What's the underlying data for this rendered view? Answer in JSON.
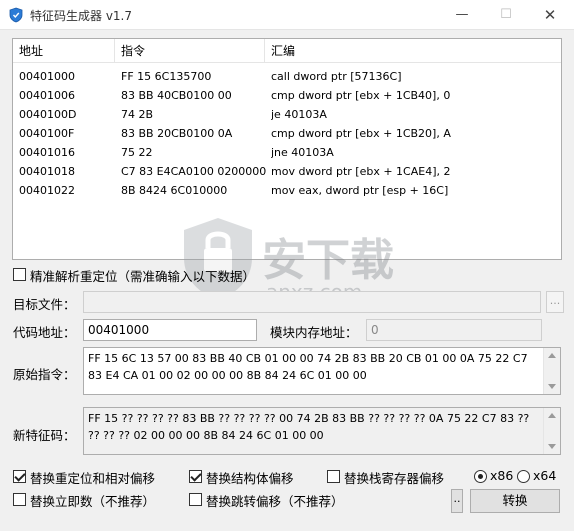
{
  "window": {
    "title": "特征码生成器 v1.7",
    "min_glyph": "—",
    "max_glyph": "☐",
    "close_glyph": "✕"
  },
  "listview": {
    "columns": [
      "地址",
      "指令",
      "汇编"
    ],
    "rows": [
      [
        "00401000",
        "FF 15 6C135700",
        "call dword ptr [57136C]"
      ],
      [
        "00401006",
        "83 BB 40CB0100 00",
        "cmp dword ptr [ebx + 1CB40], 0"
      ],
      [
        "0040100D",
        "74 2B",
        "je 40103A"
      ],
      [
        "0040100F",
        "83 BB 20CB0100 0A",
        "cmp dword ptr [ebx + 1CB20], A"
      ],
      [
        "00401016",
        "75 22",
        "jne 40103A"
      ],
      [
        "00401018",
        "C7 83 E4CA0100 02000000",
        "mov dword ptr [ebx + 1CAE4], 2"
      ],
      [
        "00401022",
        "8B 8424 6C010000",
        "mov eax, dword ptr [esp + 16C]"
      ]
    ]
  },
  "precise": {
    "label": "精准解析重定位（需准确输入以下数据）",
    "checked": false
  },
  "target_file": {
    "label": "目标文件：",
    "value": "",
    "browse_label": "..."
  },
  "code_address": {
    "label": "代码地址：",
    "value": "00401000"
  },
  "module_base": {
    "label": "模块内存地址：",
    "value": "0"
  },
  "original_code": {
    "label": "原始指令：",
    "value": "FF 15 6C 13 57 00 83 BB 40 CB 01 00 00 74 2B 83 BB 20 CB 01 00 0A 75 22 C7 83 E4 CA 01 00 02 00 00 00 8B 84 24 6C 01 00 00"
  },
  "new_signature": {
    "label": "新特征码：",
    "value": "FF 15 ?? ?? ?? ?? 83 BB ?? ?? ?? ?? 00 74 2B 83 BB ?? ?? ?? ?? 0A 75 22 C7 83 ?? ?? ?? ?? 02 00 00 00 8B 84 24 6C 01 00 00"
  },
  "options": [
    {
      "label": "替换重定位和相对偏移",
      "checked": true
    },
    {
      "label": "替换结构体偏移",
      "checked": true
    },
    {
      "label": "替换栈寄存器偏移",
      "checked": false
    },
    {
      "label": "替换立即数（不推荐）",
      "checked": false
    },
    {
      "label": "替换跳转偏移（不推荐）",
      "checked": false
    }
  ],
  "arch": {
    "x86": "x86",
    "x64": "x64",
    "selected": "x86"
  },
  "buttons": {
    "more_label": "..",
    "convert_label": "转换"
  },
  "colors": {
    "accent": "#2b7bd6",
    "watermark_orange": "#e8801a"
  },
  "watermark": {
    "main": "安下载",
    "sub": "anxz.com"
  }
}
